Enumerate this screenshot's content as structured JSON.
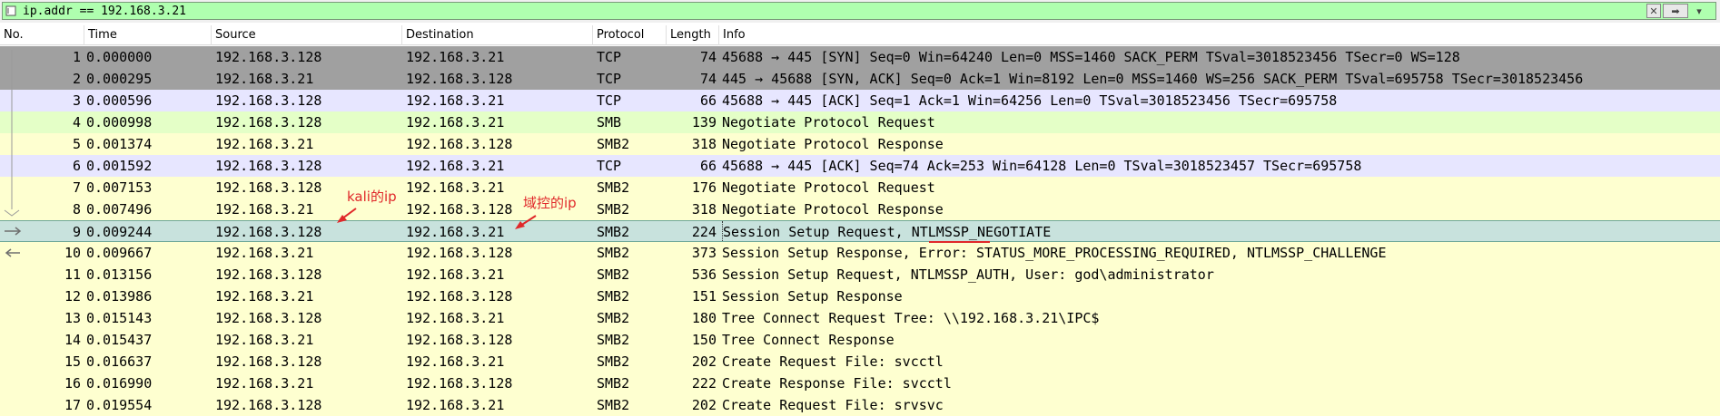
{
  "filter": {
    "value": "ip.addr == 192.168.3.21",
    "clear_label": "✕",
    "apply_label": "➡",
    "dropdown_label": "▾"
  },
  "columns": [
    "No.",
    "Time",
    "Source",
    "Destination",
    "Protocol",
    "Length",
    "Info"
  ],
  "packets": [
    {
      "no": "1",
      "time": "0.000000",
      "src": "192.168.3.128",
      "dst": "192.168.3.21",
      "proto": "TCP",
      "len": "74",
      "info": "45688 → 445 [SYN] Seq=0 Win=64240 Len=0 MSS=1460 SACK_PERM TSval=3018523456 TSecr=0 WS=128",
      "style": "tcp-gray"
    },
    {
      "no": "2",
      "time": "0.000295",
      "src": "192.168.3.21",
      "dst": "192.168.3.128",
      "proto": "TCP",
      "len": "74",
      "info": "445 → 45688 [SYN, ACK] Seq=0 Ack=1 Win=8192 Len=0 MSS=1460 WS=256 SACK_PERM TSval=695758 TSecr=3018523456",
      "style": "tcp-gray"
    },
    {
      "no": "3",
      "time": "0.000596",
      "src": "192.168.3.128",
      "dst": "192.168.3.21",
      "proto": "TCP",
      "len": "66",
      "info": "45688 → 445 [ACK] Seq=1 Ack=1 Win=64256 Len=0 TSval=3018523456 TSecr=695758",
      "style": "tcp-lav"
    },
    {
      "no": "4",
      "time": "0.000998",
      "src": "192.168.3.128",
      "dst": "192.168.3.21",
      "proto": "SMB",
      "len": "139",
      "info": "Negotiate Protocol Request",
      "style": "smb-green"
    },
    {
      "no": "5",
      "time": "0.001374",
      "src": "192.168.3.21",
      "dst": "192.168.3.128",
      "proto": "SMB2",
      "len": "318",
      "info": "Negotiate Protocol Response",
      "style": "smb-yellow"
    },
    {
      "no": "6",
      "time": "0.001592",
      "src": "192.168.3.128",
      "dst": "192.168.3.21",
      "proto": "TCP",
      "len": "66",
      "info": "45688 → 445 [ACK] Seq=74 Ack=253 Win=64128 Len=0 TSval=3018523457 TSecr=695758",
      "style": "tcp-lav"
    },
    {
      "no": "7",
      "time": "0.007153",
      "src": "192.168.3.128",
      "dst": "192.168.3.21",
      "proto": "SMB2",
      "len": "176",
      "info": "Negotiate Protocol Request",
      "style": "smb-yellow"
    },
    {
      "no": "8",
      "time": "0.007496",
      "src": "192.168.3.21",
      "dst": "192.168.3.128",
      "proto": "SMB2",
      "len": "318",
      "info": "Negotiate Protocol Response",
      "style": "smb-yellow"
    },
    {
      "no": "9",
      "time": "0.009244",
      "src": "192.168.3.128",
      "dst": "192.168.3.21",
      "proto": "SMB2",
      "len": "224",
      "info": "Session Setup Request, NTLMSSP_NEGOTIATE",
      "style": "selected"
    },
    {
      "no": "10",
      "time": "0.009667",
      "src": "192.168.3.21",
      "dst": "192.168.3.128",
      "proto": "SMB2",
      "len": "373",
      "info": "Session Setup Response, Error: STATUS_MORE_PROCESSING_REQUIRED, NTLMSSP_CHALLENGE",
      "style": "smb-yellow"
    },
    {
      "no": "11",
      "time": "0.013156",
      "src": "192.168.3.128",
      "dst": "192.168.3.21",
      "proto": "SMB2",
      "len": "536",
      "info": "Session Setup Request, NTLMSSP_AUTH, User: god\\administrator",
      "style": "smb-yellow"
    },
    {
      "no": "12",
      "time": "0.013986",
      "src": "192.168.3.21",
      "dst": "192.168.3.128",
      "proto": "SMB2",
      "len": "151",
      "info": "Session Setup Response",
      "style": "smb-yellow"
    },
    {
      "no": "13",
      "time": "0.015143",
      "src": "192.168.3.128",
      "dst": "192.168.3.21",
      "proto": "SMB2",
      "len": "180",
      "info": "Tree Connect Request Tree: \\\\192.168.3.21\\IPC$",
      "style": "smb-yellow"
    },
    {
      "no": "14",
      "time": "0.015437",
      "src": "192.168.3.21",
      "dst": "192.168.3.128",
      "proto": "SMB2",
      "len": "150",
      "info": "Tree Connect Response",
      "style": "smb-yellow"
    },
    {
      "no": "15",
      "time": "0.016637",
      "src": "192.168.3.128",
      "dst": "192.168.3.21",
      "proto": "SMB2",
      "len": "202",
      "info": "Create Request File: svcctl",
      "style": "smb-yellow"
    },
    {
      "no": "16",
      "time": "0.016990",
      "src": "192.168.3.21",
      "dst": "192.168.3.128",
      "proto": "SMB2",
      "len": "222",
      "info": "Create Response File: svcctl",
      "style": "smb-yellow"
    },
    {
      "no": "17",
      "time": "0.019554",
      "src": "192.168.3.128",
      "dst": "192.168.3.21",
      "proto": "SMB2",
      "len": "202",
      "info": "Create Request File: srvsvc",
      "style": "smb-yellow"
    }
  ],
  "annotations": {
    "kali_label": "kali的ip",
    "dc_label": "域控的ip",
    "color": "#e0282a"
  }
}
